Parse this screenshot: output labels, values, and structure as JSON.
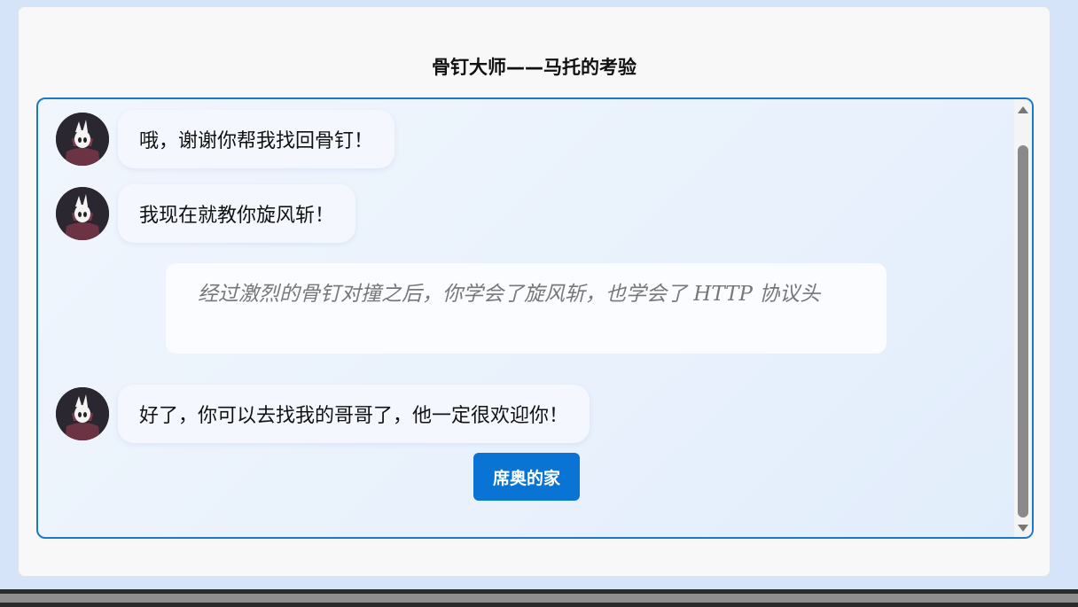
{
  "page": {
    "title": "骨钉大师——马托的考验"
  },
  "chat": {
    "messages": [
      {
        "text": "哦，谢谢你帮我找回骨钉！"
      },
      {
        "text": "我现在就教你旋风斩！"
      },
      {
        "text": "好了，你可以去找我的哥哥了，他一定很欢迎你！"
      }
    ],
    "narration": "经过激烈的骨钉对撞之后，你学会了旋风斩，也学会了 HTTP 协议头"
  },
  "actions": {
    "next_label": "席奥的家"
  },
  "colors": {
    "accent": "#0a74d4",
    "chat_border": "#1b78c8",
    "page_bg": "#d6e4fa"
  },
  "icons": {
    "avatar": "knight-avatar-icon",
    "scroll_up": "scroll-up-arrow-icon",
    "scroll_down": "scroll-down-arrow-icon"
  }
}
